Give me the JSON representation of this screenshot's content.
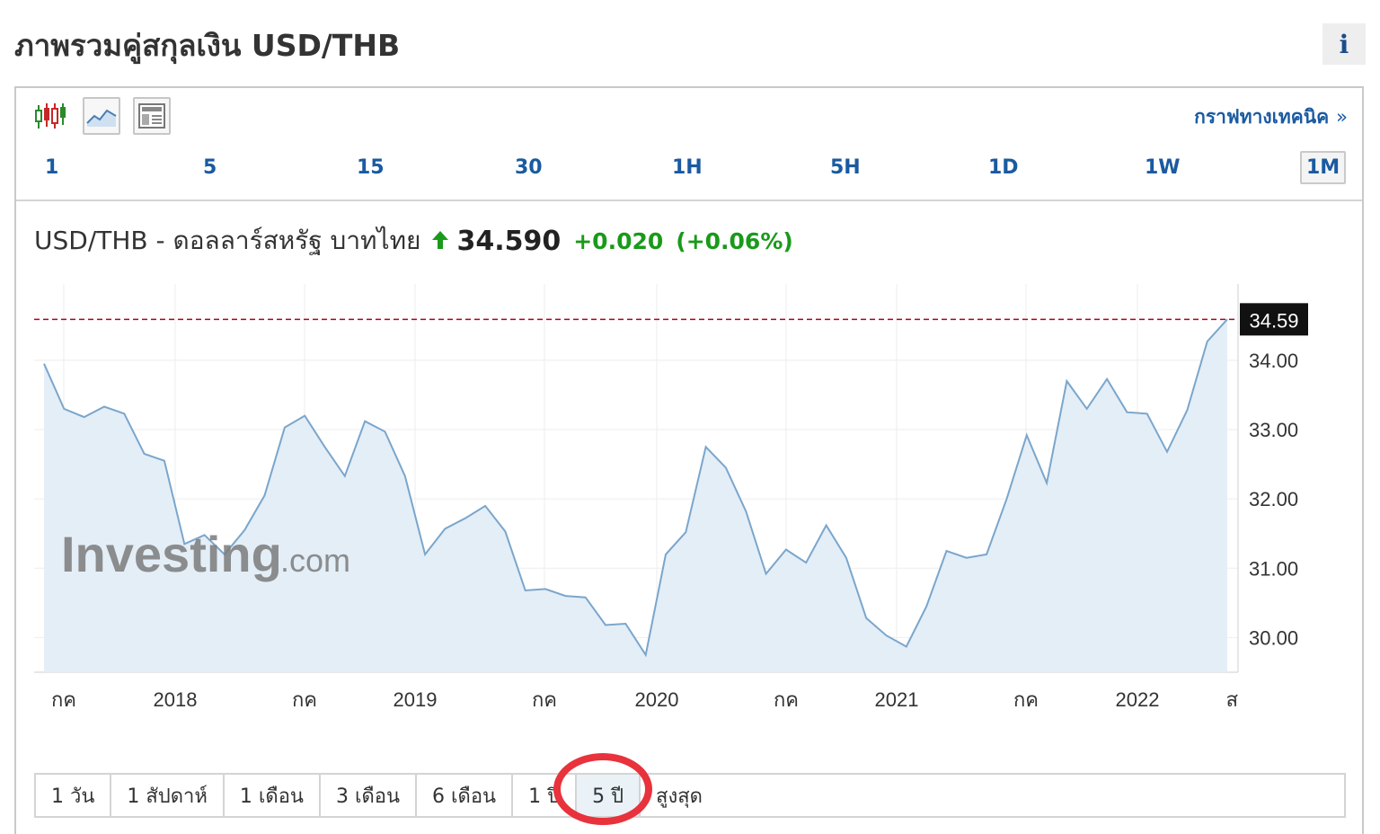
{
  "page": {
    "title": "ภาพรวมคู่สกุลเงิน USD/THB",
    "info_label": "i"
  },
  "toolbar": {
    "technical_link": "กราฟทางเทคนิค",
    "technical_chevron": "»",
    "chart_type_icons": [
      "candlestick-icon",
      "area-chart-icon",
      "table-view-icon"
    ],
    "intervals": [
      "1",
      "5",
      "15",
      "30",
      "1H",
      "5H",
      "1D",
      "1W",
      "1M"
    ],
    "active_interval": "1M"
  },
  "quote": {
    "name": "USD/THB - ดอลลาร์สหรัฐ บาทไทย",
    "price": "34.590",
    "change": "+0.020",
    "change_pct": "(+0.06%)",
    "direction": "up",
    "up_color": "#1a9a1a"
  },
  "chart_data": {
    "type": "area",
    "y_ticks": [
      "34.00",
      "33.00",
      "32.00",
      "31.00",
      "30.00"
    ],
    "ylim": [
      29.5,
      35.1
    ],
    "current_label": "34.59",
    "current_value": 34.59,
    "x_tick_labels": [
      "กค",
      "2018",
      "กค",
      "2019",
      "กค",
      "2020",
      "กค",
      "2021",
      "กค",
      "2022",
      "ส"
    ],
    "values": [
      33.95,
      33.3,
      33.18,
      33.33,
      33.23,
      32.65,
      32.55,
      31.35,
      31.48,
      31.2,
      31.55,
      32.05,
      33.03,
      33.2,
      32.75,
      32.33,
      33.12,
      32.97,
      32.33,
      31.2,
      31.57,
      31.72,
      31.9,
      31.53,
      30.68,
      30.7,
      30.6,
      30.58,
      30.18,
      30.2,
      29.75,
      31.2,
      31.52,
      32.75,
      32.45,
      31.82,
      30.92,
      31.27,
      31.08,
      31.62,
      31.15,
      30.28,
      30.03,
      29.87,
      30.45,
      31.25,
      31.15,
      31.2,
      32.0,
      32.92,
      32.23,
      33.7,
      33.3,
      33.73,
      33.25,
      33.23,
      32.68,
      33.28,
      34.27,
      34.59
    ],
    "grid": true,
    "line_color": "#7aa6cc",
    "fill_color": "#e4eef7",
    "current_line_color": "#b00020",
    "watermark_main": "Investing",
    "watermark_suffix": ".com"
  },
  "range_tabs": {
    "items": [
      "1 วัน",
      "1 สัปดาห์",
      "1 เดือน",
      "3 เดือน",
      "6 เดือน",
      "1 ปี",
      "5 ปี",
      "สูงสุด"
    ],
    "active": "5 ปี",
    "highlight_color": "#e8323c"
  }
}
